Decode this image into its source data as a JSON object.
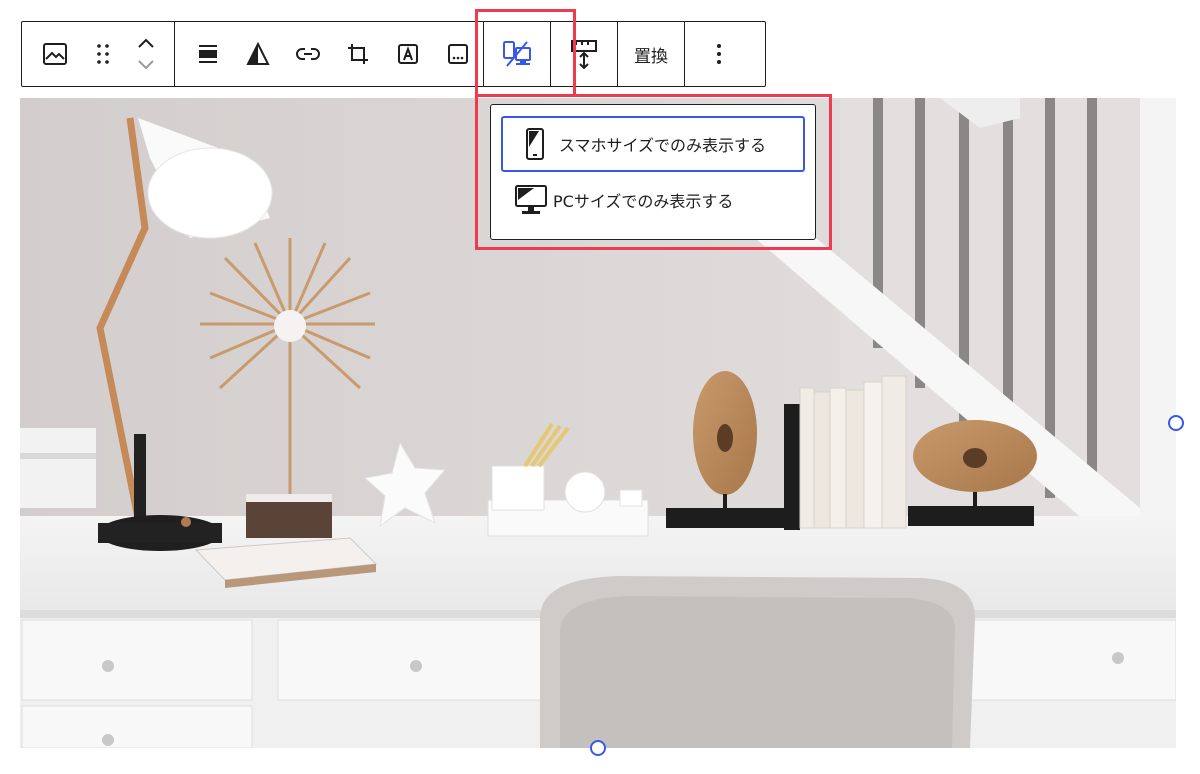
{
  "toolbar": {
    "replace_label": "置換"
  },
  "visibility_menu": {
    "items": [
      {
        "label": "スマホサイズでのみ表示する",
        "icon": "smartphone-icon"
      },
      {
        "label": "PCサイズでのみ表示する",
        "icon": "desktop-monitor-icon"
      }
    ]
  },
  "colors": {
    "accent": "#3858e9",
    "highlight": "#ef3b4f",
    "border": "#1e1e1e"
  }
}
